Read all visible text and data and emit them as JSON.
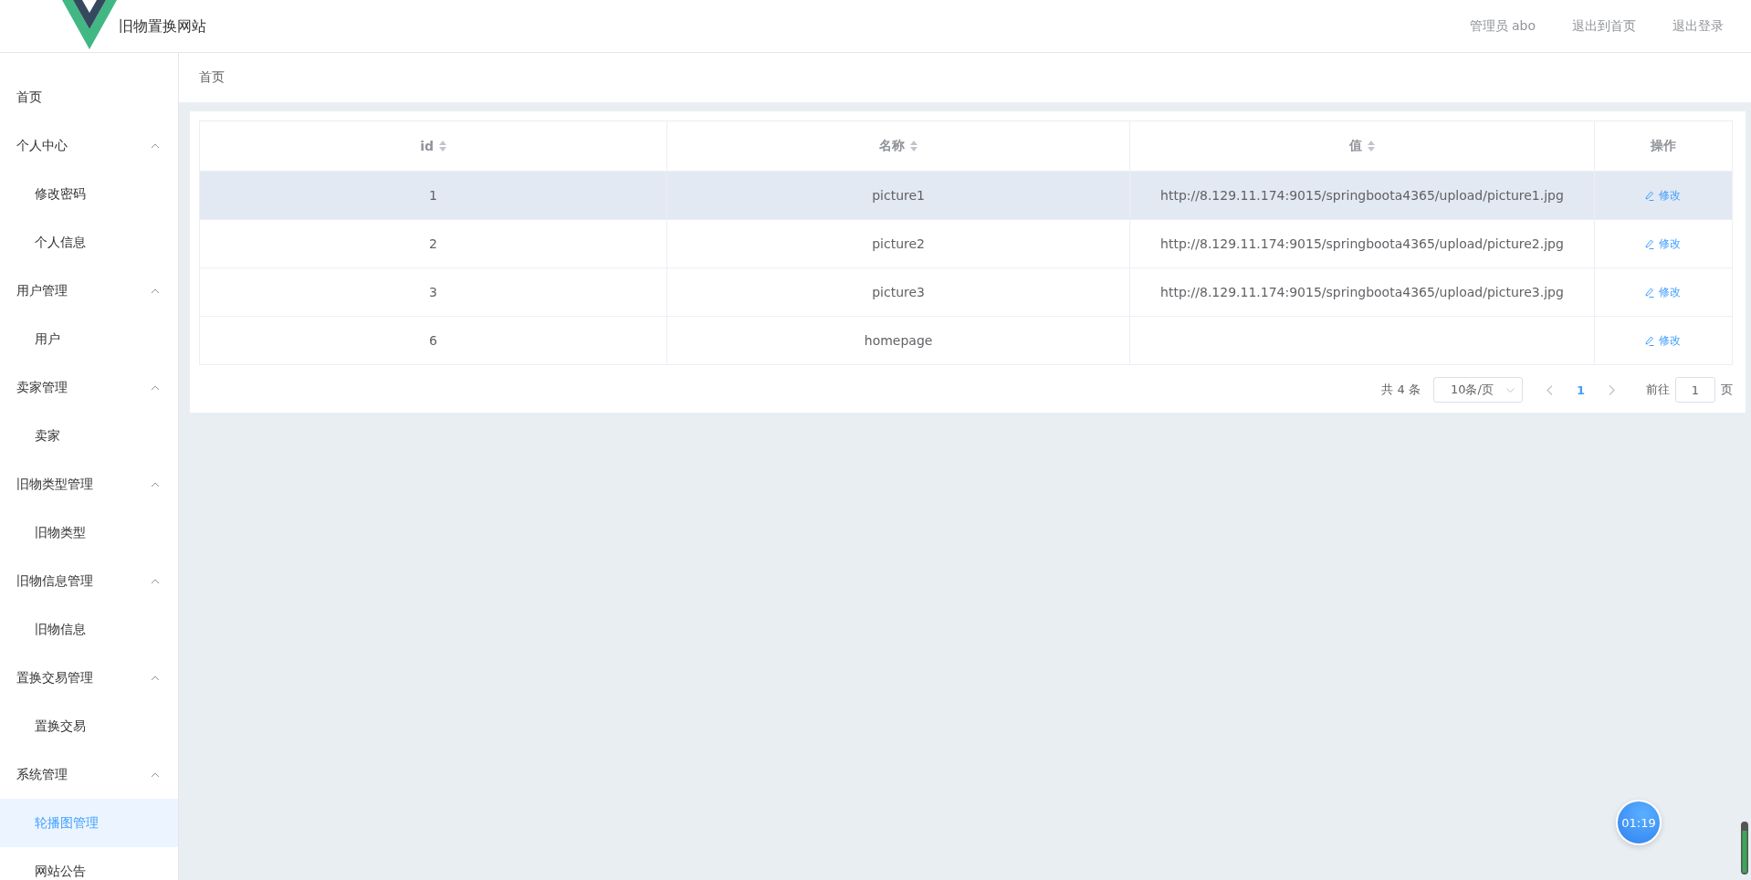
{
  "header": {
    "title": "旧物置换网站",
    "links": [
      "管理员 abo",
      "退出到首页",
      "退出登录"
    ]
  },
  "sidebar": {
    "home": {
      "label": "首页",
      "selected": false
    },
    "groups": [
      {
        "label": "个人中心",
        "expanded": true,
        "children": [
          {
            "label": "修改密码",
            "selected": false
          },
          {
            "label": "个人信息",
            "selected": false
          }
        ]
      },
      {
        "label": "用户管理",
        "expanded": true,
        "children": [
          {
            "label": "用户",
            "selected": false
          }
        ]
      },
      {
        "label": "卖家管理",
        "expanded": true,
        "children": [
          {
            "label": "卖家",
            "selected": false
          }
        ]
      },
      {
        "label": "旧物类型管理",
        "expanded": true,
        "children": [
          {
            "label": "旧物类型",
            "selected": false
          }
        ]
      },
      {
        "label": "旧物信息管理",
        "expanded": true,
        "children": [
          {
            "label": "旧物信息",
            "selected": false
          }
        ]
      },
      {
        "label": "置换交易管理",
        "expanded": true,
        "children": [
          {
            "label": "置换交易",
            "selected": false
          }
        ]
      },
      {
        "label": "系统管理",
        "expanded": true,
        "children": [
          {
            "label": "轮播图管理",
            "selected": true
          },
          {
            "label": "网站公告",
            "selected": false
          }
        ]
      }
    ]
  },
  "breadcrumb": [
    "首页"
  ],
  "table": {
    "columns": [
      {
        "label": "id",
        "sortable": true
      },
      {
        "label": "名称",
        "sortable": true
      },
      {
        "label": "值",
        "sortable": true
      },
      {
        "label": "操作",
        "sortable": false
      }
    ],
    "rows": [
      {
        "cells": [
          "1",
          "picture1",
          "http://8.129.11.174:9015/springboota4365/upload/picture1.jpg"
        ],
        "action": "修改",
        "highlighted": true
      },
      {
        "cells": [
          "2",
          "picture2",
          "http://8.129.11.174:9015/springboota4365/upload/picture2.jpg"
        ],
        "action": "修改",
        "highlighted": false
      },
      {
        "cells": [
          "3",
          "picture3",
          "http://8.129.11.174:9015/springboota4365/upload/picture3.jpg"
        ],
        "action": "修改",
        "highlighted": false
      },
      {
        "cells": [
          "6",
          "homepage",
          ""
        ],
        "action": "修改",
        "highlighted": false
      }
    ]
  },
  "pagination": {
    "total": "共 4 条",
    "page_size": "10条/页",
    "pages": [
      {
        "label": "1",
        "selected": true
      }
    ],
    "goto_label": "前往",
    "goto_value": "1",
    "goto_suffix": "页"
  },
  "timer": "01:19"
}
